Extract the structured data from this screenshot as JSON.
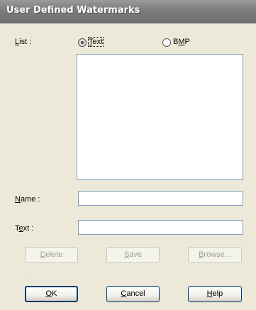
{
  "window": {
    "title": "User Defined Watermarks"
  },
  "list": {
    "label": "List :",
    "radio_text": "Text",
    "radio_bmp": "BMP",
    "selected": "Text",
    "items": []
  },
  "name_field": {
    "label": "Name :",
    "value": ""
  },
  "text_field": {
    "label": "Text :",
    "value": ""
  },
  "buttons": {
    "delete": "Delete",
    "save": "Save",
    "browse": "Browse...",
    "ok": "OK",
    "cancel": "Cancel",
    "help": "Help"
  }
}
